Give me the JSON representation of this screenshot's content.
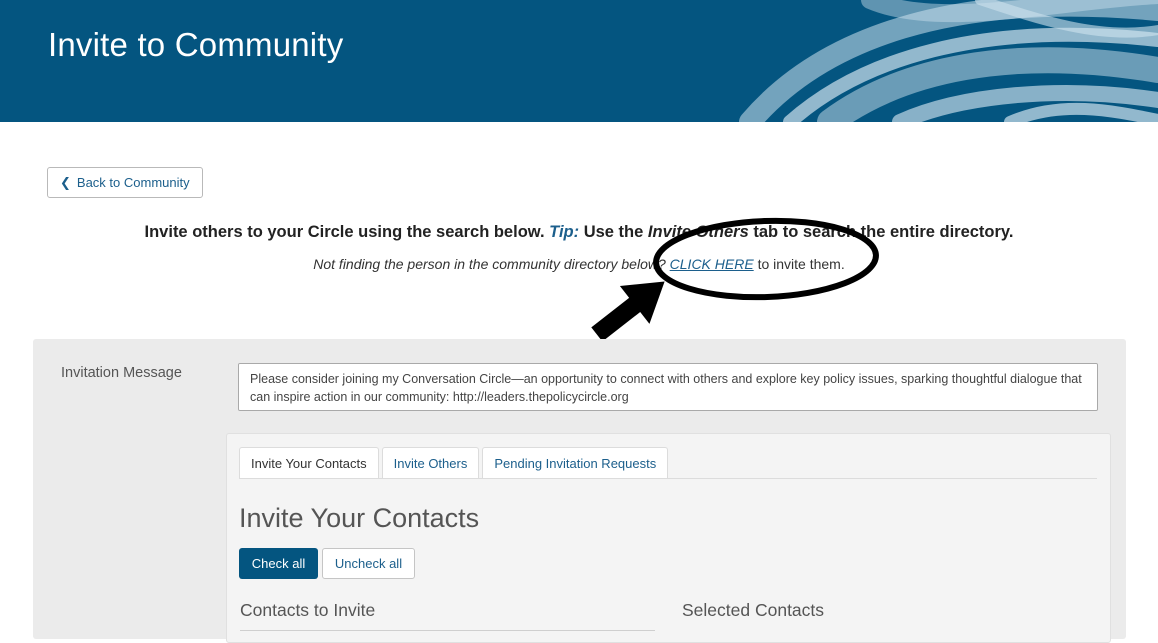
{
  "header": {
    "title": "Invite to Community"
  },
  "back_button": {
    "label": "Back to Community",
    "icon": "chevron-left-icon"
  },
  "tip": {
    "lead": "Invite others to your Circle using the search below.",
    "tip_label": "Tip:",
    "use": " Use the ",
    "tab_name": "Invite Others",
    "rest": " tab to search the entire directory."
  },
  "not_finding": {
    "question": "Not finding the person in the community directory below? ",
    "link": "CLICK HERE",
    "rest": " to invite them."
  },
  "invitation": {
    "label": "Invitation Message",
    "message": "Please consider joining my Conversation Circle—an opportunity to connect with others and explore key policy issues, sparking thoughtful dialogue that can inspire action in our community: http://leaders.thepolicycircle.org"
  },
  "tabs": [
    {
      "label": "Invite Your Contacts",
      "active": true
    },
    {
      "label": "Invite Others",
      "active": false
    },
    {
      "label": "Pending Invitation Requests",
      "active": false
    }
  ],
  "section": {
    "title": "Invite Your Contacts",
    "check_all": "Check all",
    "uncheck_all": "Uncheck all",
    "contacts_to_invite": "Contacts to Invite",
    "selected_contacts": "Selected Contacts"
  },
  "colors": {
    "brand": "#045580",
    "link": "#1c5f8c",
    "panel": "#ebebeb"
  }
}
